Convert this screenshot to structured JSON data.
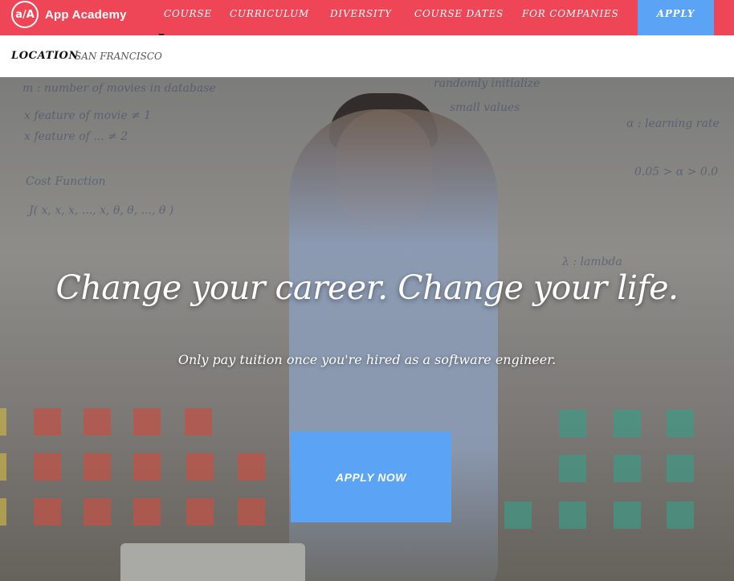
{
  "brand": {
    "logo_glyph": "a/A",
    "name": "App Academy"
  },
  "nav": {
    "items": [
      "COURSE",
      "CURRICULUM",
      "DIVERSITY",
      "COURSE DATES",
      "FOR COMPANIES"
    ],
    "apply_label": "APPLY"
  },
  "location": {
    "label": "LOCATION",
    "value": "SAN FRANCISCO"
  },
  "hero": {
    "headline": "Change your career. Change your life.",
    "subheadline": "Only pay tuition once you're hired as a software engineer.",
    "cta_label": "APPLY NOW"
  },
  "colors": {
    "topbar": "#ef4657",
    "accent_blue": "#5aa3f5"
  }
}
